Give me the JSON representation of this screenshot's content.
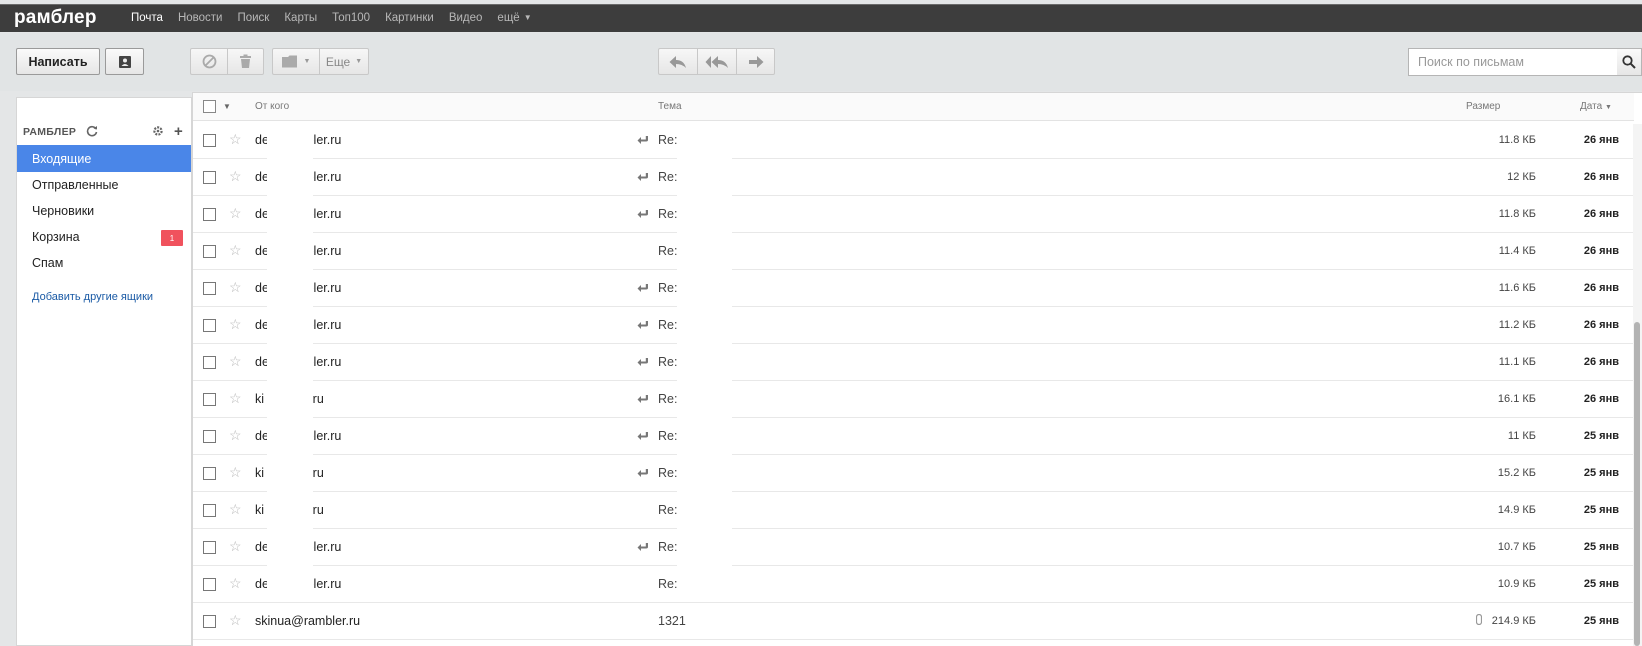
{
  "topbar": {
    "logo": "рамблер",
    "nav": [
      "Почта",
      "Новости",
      "Поиск",
      "Карты",
      "Топ100",
      "Картинки",
      "Видео",
      "ещё"
    ]
  },
  "toolbar": {
    "write_label": "Написать",
    "more_label": "Еще",
    "search_placeholder": "Поиск по письмам"
  },
  "sidebar": {
    "account_title": "РАМБЛЕР",
    "folders": [
      {
        "label": "Входящие",
        "active": true
      },
      {
        "label": "Отправленные"
      },
      {
        "label": "Черновики"
      },
      {
        "label": "Корзина",
        "badge": "1"
      },
      {
        "label": "Спам"
      }
    ],
    "add_boxes_link": "Добавить другие ящики"
  },
  "list": {
    "headers": {
      "from": "От кого",
      "subject": "Тема",
      "size": "Размер",
      "date": "Дата"
    },
    "rows": [
      {
        "from": "de            @rambler.ru",
        "subject": "Re:",
        "replied": true,
        "size": "11.8 КБ",
        "date": "26 янв"
      },
      {
        "from": "de            @rambler.ru",
        "subject": "Re:",
        "replied": true,
        "size": "12 КБ",
        "date": "26 янв"
      },
      {
        "from": "de            @rambler.ru",
        "subject": "Re:",
        "replied": true,
        "size": "11.8 КБ",
        "date": "26 янв"
      },
      {
        "from": "de            @rambler.ru",
        "subject": "Re:",
        "replied": false,
        "size": "11.4 КБ",
        "date": "26 янв"
      },
      {
        "from": "de            @rambler.ru",
        "subject": "Re:",
        "replied": true,
        "size": "11.6 КБ",
        "date": "26 янв"
      },
      {
        "from": "de            @rambler.ru",
        "subject": "Re:",
        "replied": true,
        "size": "11.2 КБ",
        "date": "26 янв"
      },
      {
        "from": "de            @rambler.ru",
        "subject": "Re:",
        "replied": true,
        "size": "11.1 КБ",
        "date": "26 янв"
      },
      {
        "from": "ki             rambler.ru",
        "subject": "Re:",
        "replied": true,
        "size": "16.1 КБ",
        "date": "26 янв"
      },
      {
        "from": "de            @rambler.ru",
        "subject": "Re:",
        "replied": true,
        "size": "11 КБ",
        "date": "25 янв"
      },
      {
        "from": "ki             rambler.ru",
        "subject": "Re:",
        "replied": true,
        "size": "15.2 КБ",
        "date": "25 янв"
      },
      {
        "from": "ki             rambler.ru",
        "subject": "Re:",
        "replied": false,
        "size": "14.9 КБ",
        "date": "25 янв"
      },
      {
        "from": "de            @rambler.ru",
        "subject": "Re:",
        "replied": true,
        "size": "10.7 КБ",
        "date": "25 янв"
      },
      {
        "from": "de            @rambler.ru",
        "subject": "Re:",
        "replied": false,
        "size": "10.9 КБ",
        "date": "25 янв"
      },
      {
        "from": "skinua@rambler.ru",
        "subject": "1321",
        "replied": false,
        "attachment": true,
        "size": "214.9 КБ",
        "date": "25 янв"
      }
    ]
  },
  "colors": {
    "topbar": "#3d3d3d",
    "accent": "#4a86e8",
    "badge": "#f0525d",
    "link": "#1a5aa5"
  }
}
